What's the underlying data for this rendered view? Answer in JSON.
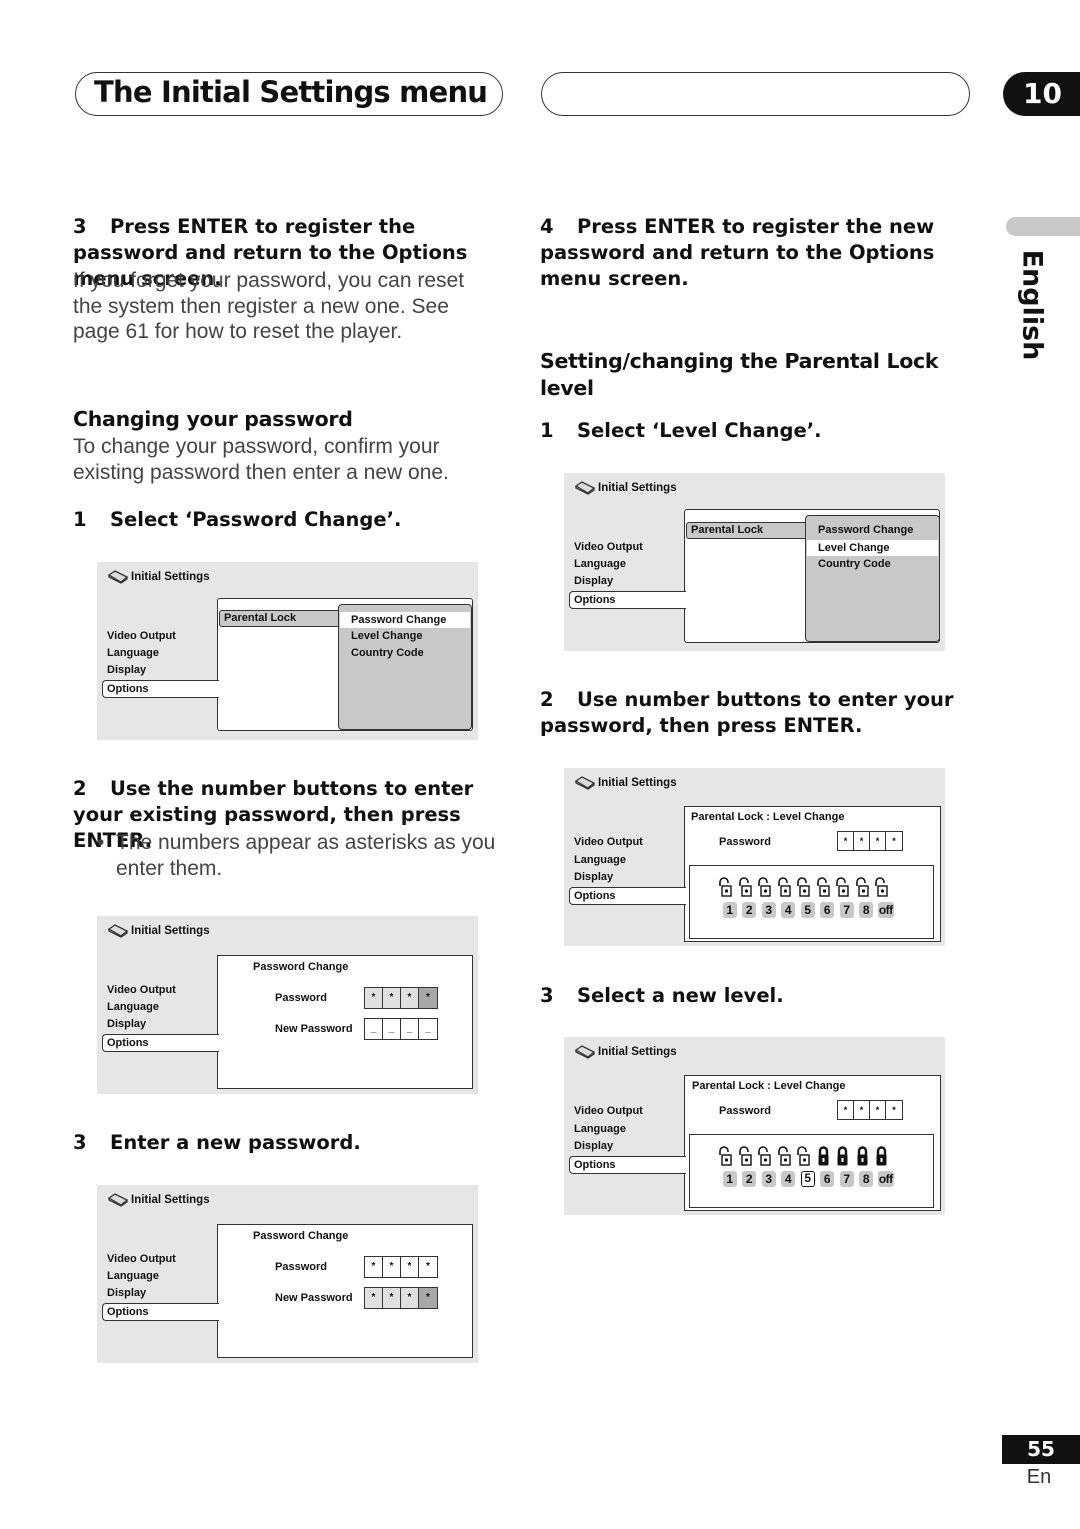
{
  "header": {
    "title": "The Initial Settings menu",
    "chapter": "10"
  },
  "side_tab": {
    "language": "English"
  },
  "footer": {
    "page_number": "55",
    "language_code": "En"
  },
  "left_column": {
    "step3": {
      "num": "3",
      "text": "Press ENTER to register the password and return to the Options menu screen.",
      "body": "If you forget your password, you can reset the system then register a new one. See page 61 for how to reset the player."
    },
    "section_title": "Changing your password",
    "section_body": "To change your password, confirm your existing password then enter a new one.",
    "step1": {
      "num": "1",
      "text": "Select ‘Password Change’."
    },
    "step2": {
      "num": "2",
      "text": "Use the number buttons to enter your existing password, then press ENTER.",
      "bullet": "The numbers appear as asterisks as you enter them."
    },
    "step3b": {
      "num": "3",
      "text": "Enter a new password."
    }
  },
  "right_column": {
    "step4": {
      "num": "4",
      "text": "Press ENTER to register the new password and return to the Options menu screen."
    },
    "section_title": "Setting/changing the Parental Lock level",
    "step1": {
      "num": "1",
      "text": "Select ‘Level Change’."
    },
    "step2": {
      "num": "2",
      "text": "Use number buttons to enter your password, then press ENTER."
    },
    "step3": {
      "num": "3",
      "text": "Select a new level."
    }
  },
  "osd": {
    "title": "Initial Settings",
    "left_menu": [
      "Video Output",
      "Language",
      "Display",
      "Options"
    ],
    "selected_left": "Options",
    "parental_lock": "Parental Lock",
    "submenu": [
      "Password Change",
      "Level Change",
      "Country Code"
    ],
    "password_change_title": "Password Change",
    "password_label": "Password",
    "new_password_label": "New Password",
    "level_change_title": "Parental Lock : Level Change",
    "asterisk": "*",
    "blank": "_",
    "levels": [
      "1",
      "2",
      "3",
      "4",
      "5",
      "6",
      "7",
      "8",
      "off"
    ],
    "screen_a_selected": "Password Change",
    "screen_e_selected": "Level Change",
    "screen_g_current_level": "5"
  }
}
